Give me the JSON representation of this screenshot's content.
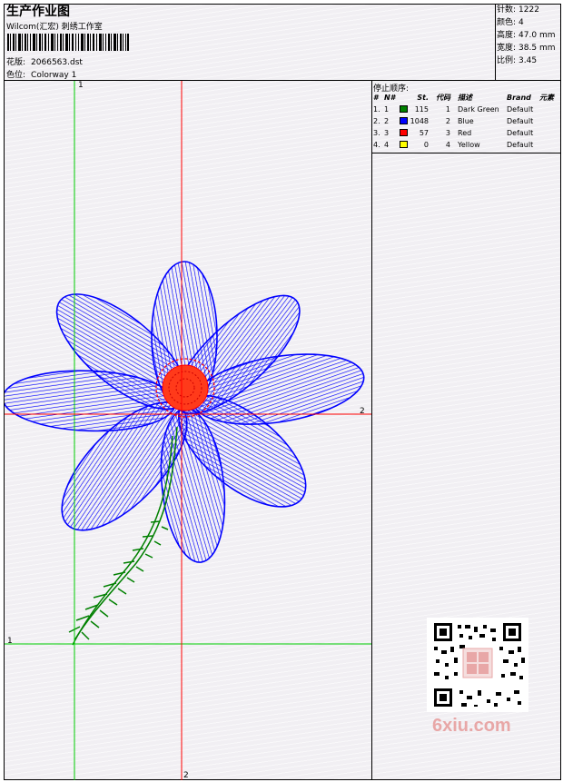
{
  "header": {
    "title": "生产作业图",
    "company": "Wilcom(汇宏) 刺绣工作室",
    "design_label": "花版:",
    "design_value": "2066563.dst",
    "colorway_label": "色位:",
    "colorway_value": "Colorway 1"
  },
  "info": [
    {
      "label": "针数:",
      "value": "1222"
    },
    {
      "label": "颜色:",
      "value": "4"
    },
    {
      "label": "高度:",
      "value": "47.0 mm"
    },
    {
      "label": "宽度:",
      "value": "38.5 mm"
    },
    {
      "label": "比例:",
      "value": "3.45"
    }
  ],
  "stop_sequence": {
    "title": "停止顺序:",
    "headers": {
      "idx": "#",
      "num": "N#",
      "st": "St.",
      "code": "代码",
      "desc": "描述",
      "brand": "Brand",
      "elem": "元素"
    },
    "rows": [
      {
        "idx": "1.",
        "num": "1",
        "color": "#008000",
        "st": "115",
        "code": "1",
        "desc": "Dark Green",
        "brand": "Default"
      },
      {
        "idx": "2.",
        "num": "2",
        "color": "#0000ff",
        "st": "1048",
        "code": "2",
        "desc": "Blue",
        "brand": "Default"
      },
      {
        "idx": "3.",
        "num": "3",
        "color": "#ff0000",
        "st": "57",
        "code": "3",
        "desc": "Red",
        "brand": "Default"
      },
      {
        "idx": "4.",
        "num": "4",
        "color": "#ffff00",
        "st": "0",
        "code": "4",
        "desc": "Yellow",
        "brand": "Default"
      }
    ]
  },
  "axes": {
    "green_top": "1",
    "green_left": "1",
    "red_right": "2",
    "red_bottom": "2"
  },
  "colors": {
    "petal": "#0000ff",
    "center": "#ff0000",
    "stem": "#008000",
    "green_axis": "#00cc00",
    "red_axis": "#ff0000"
  },
  "watermark": "6xiu.com"
}
